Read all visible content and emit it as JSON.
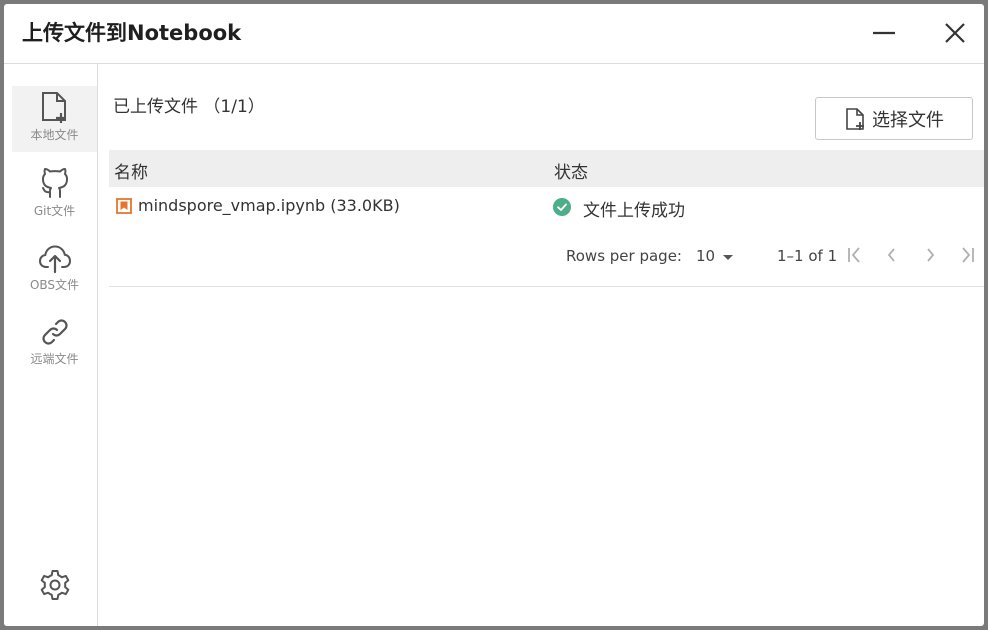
{
  "window": {
    "title": "上传文件到Notebook"
  },
  "sidebar": {
    "items": [
      {
        "label": "本地文件",
        "icon": "local-file-icon",
        "active": true
      },
      {
        "label": "Git文件",
        "icon": "github-icon",
        "active": false
      },
      {
        "label": "OBS文件",
        "icon": "cloud-upload-icon",
        "active": false
      },
      {
        "label": "远端文件",
        "icon": "link-icon",
        "active": false
      }
    ],
    "settings_icon": "gear-icon"
  },
  "main": {
    "upload_count": "已上传文件 （1/1）",
    "select_button": "选择文件",
    "table": {
      "headers": {
        "name": "名称",
        "status": "状态"
      },
      "rows": [
        {
          "name": "mindspore_vmap.ipynb (33.0KB)",
          "status": "文件上传成功",
          "status_color": "#4caf8a",
          "file_icon_color": "#e8742c"
        }
      ]
    },
    "pagination": {
      "rows_per_page_label": "Rows per page:",
      "rows_per_page": "10",
      "range": "1–1 of 1"
    }
  },
  "colors": {
    "success": "#4caf8a",
    "file_icon": "#e8742c",
    "divider": "#dcdcdc",
    "header_bg": "#eeeeee"
  }
}
